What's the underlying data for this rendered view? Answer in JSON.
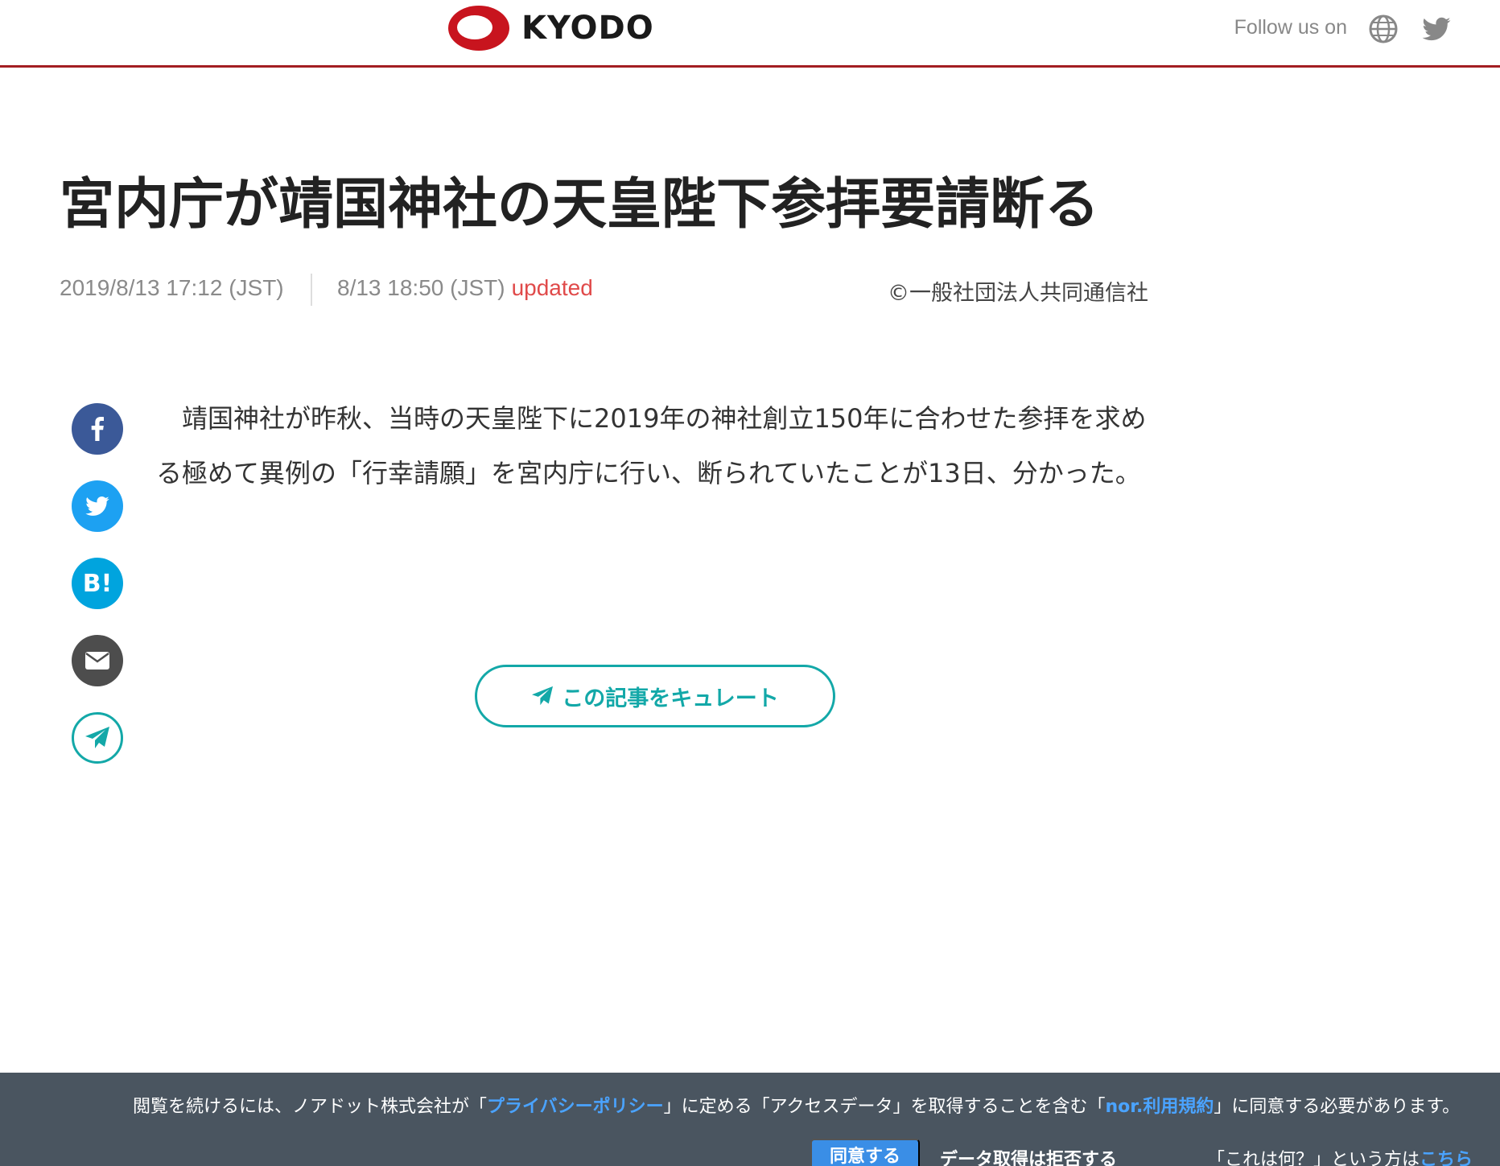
{
  "header": {
    "logo_text": "KYODO",
    "follow_text": "Follow us on",
    "colors": {
      "accent": "#a31e22",
      "logo_red": "#c8141e"
    }
  },
  "article": {
    "title": "宮内庁が靖国神社の天皇陛下参拝要請断る",
    "posted": "2019/8/13 17:12 (JST)",
    "updated_time": "8/13 18:50 (JST)",
    "updated_label": "updated",
    "copyright": "©一般社団法人共同通信社",
    "body": "　靖国神社が昨秋、当時の天皇陛下に2019年の神社創立150年に合わせた参拝を求める極めて異例の「行幸請願」を宮内庁に行い、断られていたことが13日、分かった。"
  },
  "share": {
    "items": [
      {
        "name": "facebook",
        "icon": "facebook-icon",
        "color": "#3b5998"
      },
      {
        "name": "twitter",
        "icon": "twitter-icon",
        "color": "#1da1f2"
      },
      {
        "name": "hatena",
        "icon": "hatena-bookmark-icon",
        "label": "B!",
        "color": "#00a4de"
      },
      {
        "name": "email",
        "icon": "mail-icon",
        "color": "#4d4d4d"
      },
      {
        "name": "curate",
        "icon": "paper-plane-icon",
        "color": "#13a8a8"
      }
    ]
  },
  "curate_button": {
    "label": "この記事をキュレート"
  },
  "consent": {
    "msg_part1": "閲覧を続けるには、ノアドット株式会社が「",
    "privacy_link": "プライバシーポリシー",
    "msg_part2": "」に定める「アクセスデータ」を取得することを含む「",
    "terms_link": "nor.利用規約",
    "msg_part3": "」に同意する必要があります。",
    "agree_label": "同意する",
    "reject_label": "データ取得は拒否する",
    "what_text": "「これは何？」という方は",
    "what_link": "こちら"
  }
}
